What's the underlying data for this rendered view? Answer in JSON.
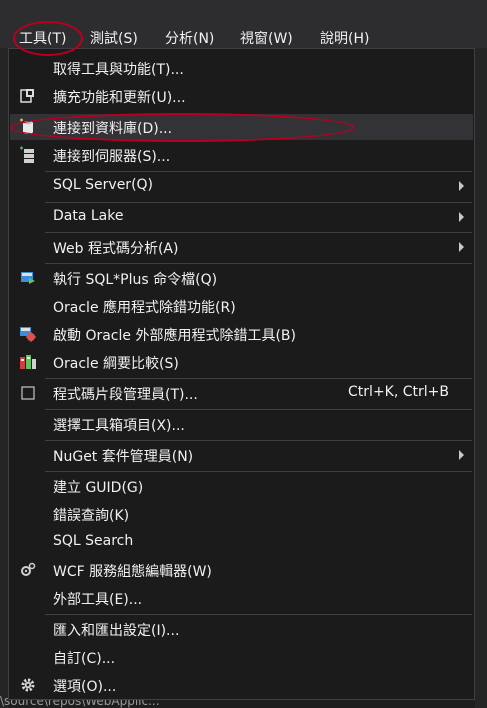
{
  "menubar": {
    "items": [
      {
        "label": "工具(T)"
      },
      {
        "label": "測試(S)"
      },
      {
        "label": "分析(N)"
      },
      {
        "label": "視窗(W)"
      },
      {
        "label": "說明(H)"
      }
    ]
  },
  "menu": {
    "items": [
      {
        "label": "取得工具與功能(T)..."
      },
      {
        "label": "擴充功能和更新(U)...",
        "icon": "extensions-icon"
      },
      {
        "label": "連接到資料庫(D)...",
        "icon": "database-connect-icon"
      },
      {
        "label": "連接到伺服器(S)...",
        "icon": "server-connect-icon"
      },
      {
        "label": "SQL Server(Q)"
      },
      {
        "label": "Data Lake"
      },
      {
        "label": "Web 程式碼分析(A)"
      },
      {
        "label": "執行 SQL*Plus 命令檔(Q)",
        "icon": "sqlplus-icon"
      },
      {
        "label": "Oracle 應用程式除錯功能(R)"
      },
      {
        "label": "啟動 Oracle 外部應用程式除錯工具(B)",
        "icon": "oracle-debug-icon"
      },
      {
        "label": "Oracle 綱要比較(S)",
        "icon": "schema-compare-icon"
      },
      {
        "label": "程式碼片段管理員(T)...",
        "shortcut": "Ctrl+K, Ctrl+B",
        "icon": "snippet-manager-icon"
      },
      {
        "label": "選擇工具箱項目(X)..."
      },
      {
        "label": "NuGet 套件管理員(N)"
      },
      {
        "label": "建立 GUID(G)"
      },
      {
        "label": "錯誤查詢(K)"
      },
      {
        "label": "SQL Search"
      },
      {
        "label": "WCF 服務組態編輯器(W)",
        "icon": "wcf-config-icon"
      },
      {
        "label": "外部工具(E)..."
      },
      {
        "label": "匯入和匯出設定(I)..."
      },
      {
        "label": "自訂(C)..."
      },
      {
        "label": "選項(O)...",
        "icon": "gear-icon"
      }
    ]
  },
  "background": {
    "bottom_text": "\\source\\repos\\WebApplic..."
  },
  "colors": {
    "annotation": "#b8001e",
    "menu_bg": "#1b1b1c",
    "highlight": "#333337"
  }
}
